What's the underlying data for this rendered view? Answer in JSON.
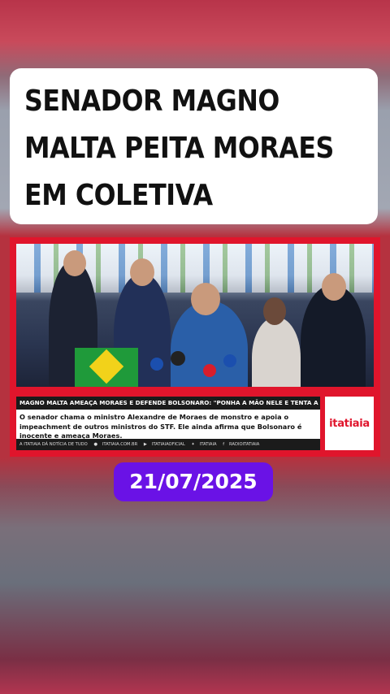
{
  "headline": {
    "lines": [
      "SENADOR MAGNO",
      "MALTA PEITA MORAES",
      "EM COLETIVA"
    ]
  },
  "news": {
    "title": "MAGNO MALTA AMEAÇA MORAES E DEFENDE BOLSONARO: \"PONHA A MÃO NELE E TENTA A SORTE\"",
    "body": "O senador chama o ministro Alexandre de Moraes de monstro e apoia o impeachment de outros ministros do STF. Ele ainda afirma que Bolsonaro é inocente e ameaça Moraes.",
    "footer": {
      "tagline": "A ITATIAIA DÁ NOTÍCIA DE TUDO",
      "site": "ITATIAIA.COM.BR",
      "instagram": "ITATIAIAOFICIAL",
      "twitter": "ITATIAIA",
      "facebook": "RADIOITATIAIA"
    },
    "brand": "itatiaia"
  },
  "date": "21/07/2025",
  "colors": {
    "accent_red": "#e0152c",
    "date_pill": "#6a12e6"
  }
}
